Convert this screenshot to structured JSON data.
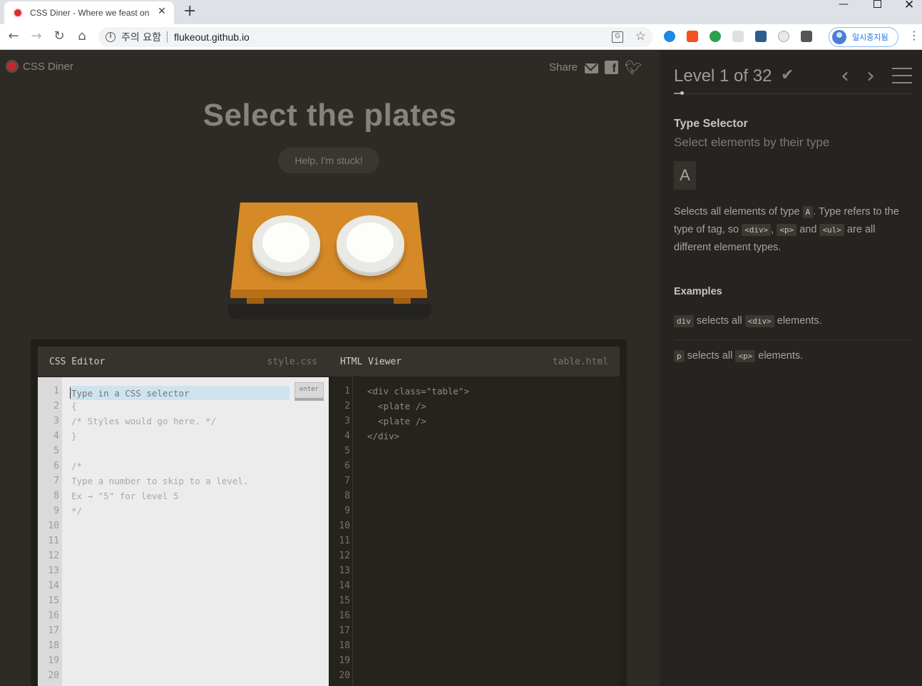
{
  "browser": {
    "tab_title": "CSS Diner - Where we feast on",
    "security_label": "주의 요함",
    "url": "flukeout.github.io",
    "profile_label": "일시중지됨"
  },
  "header": {
    "logo_text": "CSS Diner",
    "share_label": "Share"
  },
  "main": {
    "order_title": "Select the plates",
    "help_button": "Help, I'm stuck!"
  },
  "css_editor": {
    "title": "CSS Editor",
    "file": "style.css",
    "placeholder": "Type in a CSS selector",
    "enter_label": "enter",
    "line_numbers": [
      "1",
      "2",
      "3",
      "4",
      "5",
      "6",
      "7",
      "8",
      "9",
      "10",
      "11",
      "12",
      "13",
      "14",
      "15",
      "16",
      "17",
      "18",
      "19",
      "20"
    ],
    "code_lines": [
      "{",
      "/* Styles would go here. */",
      "}",
      "",
      "/*",
      "Type a number to skip to a level.",
      "Ex → \"5\" for level 5",
      "*/"
    ]
  },
  "html_viewer": {
    "title": "HTML Viewer",
    "file": "table.html",
    "code_lines": [
      "<div class=\"table\">",
      "  <plate />",
      "  <plate />",
      "</div>"
    ]
  },
  "sidebar": {
    "level_label": "Level 1 of 32",
    "level_progress": 0.03,
    "selector_name": "Type Selector",
    "selector_title": "Select elements by their type",
    "syntax": "A",
    "hint_parts": [
      "Selects all elements of type ",
      "A",
      ". Type refers to the type of tag, so ",
      "<div>",
      ", ",
      "<p>",
      " and ",
      "<ul>",
      " are all different element types."
    ],
    "examples_title": "Examples",
    "examples": [
      {
        "code": "div",
        "mid": " selects all ",
        "tag": "<div>",
        "end": " elements."
      },
      {
        "code": "p",
        "mid": " selects all ",
        "tag": "<p>",
        "end": " elements."
      }
    ]
  }
}
